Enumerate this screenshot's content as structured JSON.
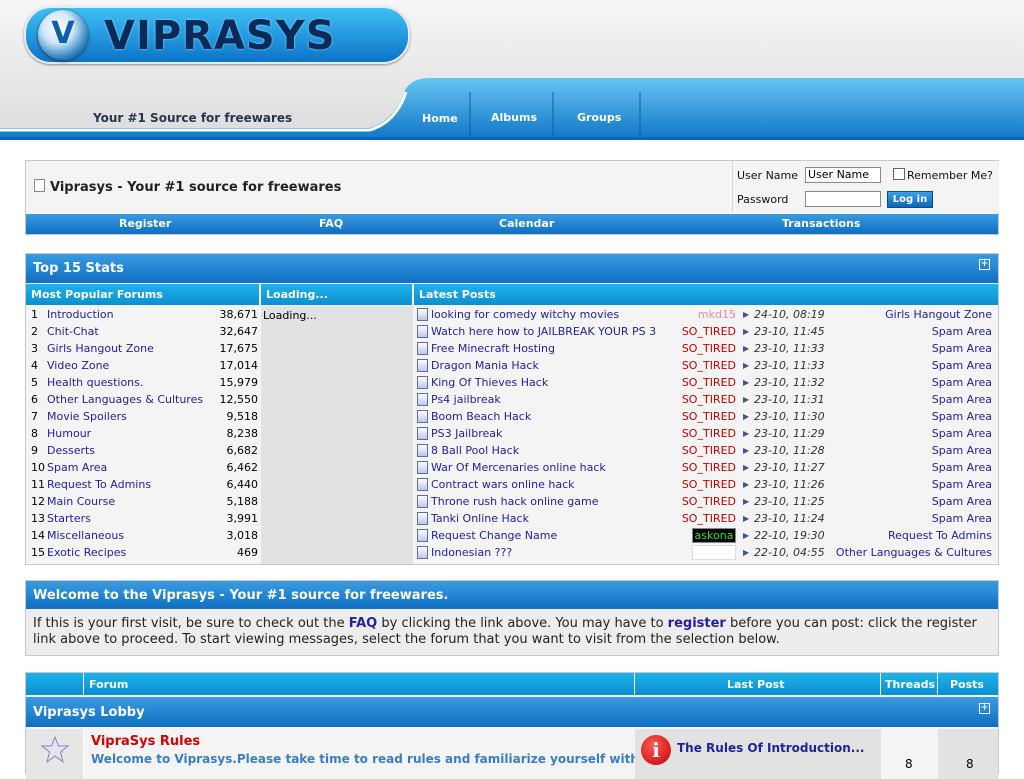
{
  "header": {
    "logo_letter": "V",
    "logo_text": "VIPRASYS",
    "tagline": "Your #1 Source for freewares",
    "nav": [
      "Home",
      "Albums",
      "Groups"
    ]
  },
  "navbar": {
    "breadcrumb": "Viprasys - Your #1 source for freewares",
    "login": {
      "username_label": "User Name",
      "username_value": "User Name",
      "password_label": "Password",
      "remember_label": "Remember Me?",
      "login_button": "Log in"
    },
    "links": [
      "Register",
      "FAQ",
      "Calendar",
      "Transactions"
    ]
  },
  "stats": {
    "title": "Top 15 Stats",
    "col1_header": "Most Popular Forums",
    "col2_header": "Loading...",
    "col2_text": "Loading...",
    "col3_header": "Latest Posts",
    "popular": [
      {
        "rank": "1",
        "name": "Introduction",
        "count": "38,671"
      },
      {
        "rank": "2",
        "name": "Chit-Chat",
        "count": "32,647"
      },
      {
        "rank": "3",
        "name": "Girls Hangout Zone",
        "count": "17,675"
      },
      {
        "rank": "4",
        "name": "Video Zone",
        "count": "17,014"
      },
      {
        "rank": "5",
        "name": "Health questions.",
        "count": "15,979"
      },
      {
        "rank": "6",
        "name": "Other Languages & Cultures",
        "count": "12,550"
      },
      {
        "rank": "7",
        "name": "Movie Spoilers",
        "count": "9,518"
      },
      {
        "rank": "8",
        "name": "Humour",
        "count": "8,238"
      },
      {
        "rank": "9",
        "name": "Desserts",
        "count": "6,682"
      },
      {
        "rank": "10",
        "name": "Spam Area",
        "count": "6,462"
      },
      {
        "rank": "11",
        "name": "Request To Admins",
        "count": "6,440"
      },
      {
        "rank": "12",
        "name": "Main Course",
        "count": "5,188"
      },
      {
        "rank": "13",
        "name": "Starters",
        "count": "3,991"
      },
      {
        "rank": "14",
        "name": "Miscellaneous",
        "count": "3,018"
      },
      {
        "rank": "15",
        "name": "Exotic Recipes",
        "count": "469"
      }
    ],
    "latest": [
      {
        "title": "looking for comedy witchy movies",
        "user": "mkd15",
        "time": "24-10, 08:19",
        "forum": "Girls Hangout Zone"
      },
      {
        "title": "Watch here how to JAILBREAK YOUR PS 3",
        "user": "SO_TIRED",
        "time": "23-10, 11:45",
        "forum": "Spam Area"
      },
      {
        "title": "Free Minecraft Hosting",
        "user": "SO_TIRED",
        "time": "23-10, 11:33",
        "forum": "Spam Area"
      },
      {
        "title": "Dragon Mania Hack",
        "user": "SO_TIRED",
        "time": "23-10, 11:33",
        "forum": "Spam Area"
      },
      {
        "title": "King Of Thieves Hack",
        "user": "SO_TIRED",
        "time": "23-10, 11:32",
        "forum": "Spam Area"
      },
      {
        "title": "Ps4 jailbreak",
        "user": "SO_TIRED",
        "time": "23-10, 11:31",
        "forum": "Spam Area"
      },
      {
        "title": "Boom Beach Hack",
        "user": "SO_TIRED",
        "time": "23-10, 11:30",
        "forum": "Spam Area"
      },
      {
        "title": "PS3 Jailbreak",
        "user": "SO_TIRED",
        "time": "23-10, 11:29",
        "forum": "Spam Area"
      },
      {
        "title": "8 Ball Pool Hack",
        "user": "SO_TIRED",
        "time": "23-10, 11:28",
        "forum": "Spam Area"
      },
      {
        "title": "War Of Mercenaries online hack",
        "user": "SO_TIRED",
        "time": "23-10, 11:27",
        "forum": "Spam Area"
      },
      {
        "title": "Contract wars online hack",
        "user": "SO_TIRED",
        "time": "23-10, 11:26",
        "forum": "Spam Area"
      },
      {
        "title": "Throne rush hack online game",
        "user": "SO_TIRED",
        "time": "23-10, 11:25",
        "forum": "Spam Area"
      },
      {
        "title": "Tanki Online Hack",
        "user": "SO_TIRED",
        "time": "23-10, 11:24",
        "forum": "Spam Area"
      },
      {
        "title": "Request Change Name",
        "user": "askona",
        "time": "22-10, 19:30",
        "forum": "Request To Admins"
      },
      {
        "title": "Indonesian ???",
        "user": "",
        "time": "22-10, 04:55",
        "forum": "Other Languages & Cultures"
      }
    ]
  },
  "welcome": {
    "title": "Welcome to the Viprasys - Your #1 source for freewares.",
    "text_1": "If this is your first visit, be sure to check out the ",
    "faq": "FAQ",
    "text_2": " by clicking the link above. You may have to ",
    "register": "register",
    "text_3": " before you can post: click the register link above to proceed. To start viewing messages, select the forum that you want to visit from the selection below."
  },
  "forums": {
    "headers": {
      "forum": "Forum",
      "last_post": "Last Post",
      "threads": "Threads",
      "posts": "Posts"
    },
    "category": "Viprasys Lobby",
    "row": {
      "title": "VipraSys Rules",
      "description": "Welcome to Viprasys.Please take time to read rules and familiarize yourself with",
      "last_post": "The Rules Of Introduction...",
      "threads": "8",
      "posts": "8"
    }
  },
  "colors": {
    "accent": "#0f6fc2",
    "thead": "#15a3de",
    "link": "#22229c",
    "username": "#c00000"
  }
}
